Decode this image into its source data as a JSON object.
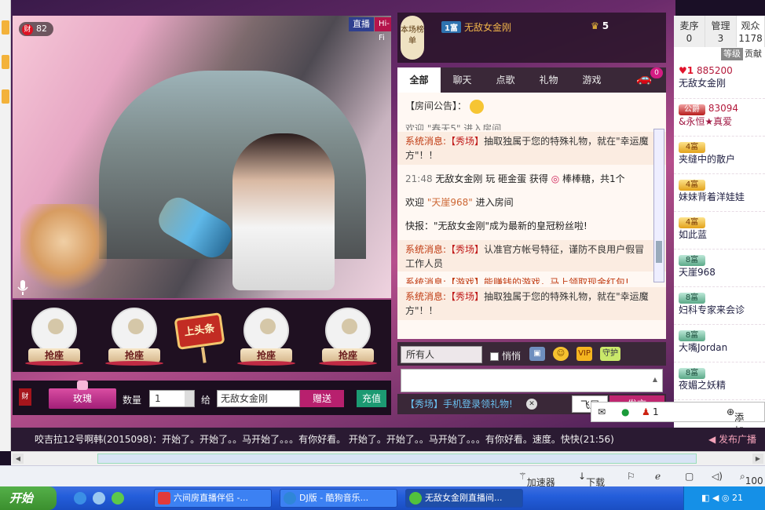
{
  "video": {
    "wealth_count": "82",
    "wealth_icon": "财",
    "live_tag": "直播",
    "hifi_tag": "Hi-Fi"
  },
  "seats": {
    "grab_label": "抢座",
    "headline_label": "上头条"
  },
  "gift_bar": {
    "fortune_icon": "财",
    "gift_name": "玫瑰",
    "qty_label": "数量",
    "qty_value": "1",
    "to_label": "给",
    "recipient": "无敌女金刚",
    "send_label": "赠送",
    "recharge_label": "充值"
  },
  "chat_head": {
    "list_badge": "本场榜单",
    "rank1_tag": "1富",
    "rank1_name": "无敌女金刚",
    "viewer_count": "5"
  },
  "chat_tabs": [
    "全部",
    "聊天",
    "点歌",
    "礼物",
    "游戏"
  ],
  "car_badge": "0",
  "chat": {
    "notice_label": "【房间公告】：",
    "partial_top": "欢迎 \"春天5\" 进入房间",
    "sys1_label": "系统消息:",
    "sys1_tag": "【秀场】",
    "sys1_text": "抽取独属于您的特殊礼物，就在\"幸运魔方\"！！",
    "gift_time": "21:48",
    "gift_user": "无敌女金刚",
    "gift_text": "玩 砸金蛋 获得",
    "gift_prize": "棒棒糖，共1个",
    "welcome_prefix": "欢迎",
    "welcome_name": "\"天崖968\"",
    "welcome_suffix": "进入房间",
    "flash": "快报：\"无敌女金刚\"成为最新的皇冠粉丝啦!",
    "sys2_label": "系统消息:",
    "sys2_tag": "【秀场】",
    "sys2_text": "认准官方帐号特征，谨防不良用户假冒工作人员",
    "partial_mid": "系统消息:【游戏】能赚钱的游戏，马上领取现金红包!",
    "sys3_label": "系统消息:",
    "sys3_tag": "【秀场】",
    "sys3_text": "抽取独属于您的特殊礼物，就在\"幸运魔方\"！！"
  },
  "chat_controls": {
    "target": "所有人",
    "whisper": "悄悄",
    "vip_icon": "VIP",
    "guard_icon": "守护"
  },
  "chat_footer": {
    "promo": "【秀场】手机登录领礼物!",
    "fly_label": "飞屏",
    "send_label": "发言"
  },
  "right_panel": {
    "tabs": [
      {
        "label": "麦序",
        "count": "0"
      },
      {
        "label": "管理",
        "count": "3"
      },
      {
        "label": "观众",
        "count": "1178"
      }
    ],
    "level_label": "等级",
    "contribution_label": "贡献",
    "users": [
      {
        "level": "1",
        "score": "885200",
        "name": "无敌女金刚"
      },
      {
        "level": "公爵",
        "score": "83094",
        "name": "&永恒★真爱"
      },
      {
        "level": "4富",
        "score": "",
        "name": "夹缝中的散户"
      },
      {
        "level": "4富",
        "score": "",
        "name": "妹妹背着洋娃娃"
      },
      {
        "level": "4富",
        "score": "",
        "name": "如此蓝"
      },
      {
        "level": "8富",
        "score": "",
        "name": "天崖968"
      },
      {
        "level": "8富",
        "score": "",
        "name": "妇科专家来会诊"
      },
      {
        "level": "8富",
        "score": "",
        "name": "大嘴Jordan"
      },
      {
        "level": "8富",
        "score": "",
        "name": "夜媚之妖精"
      }
    ]
  },
  "ticker": {
    "text": "咬吉拉12号啊韩(2015098)：开始了。开始了。。马开始了。。。有你好看。 开始了。开始了。。马开始了。。。有你好看。速度。快快(21:56)",
    "broadcast": "发布广播"
  },
  "notify": {
    "user_count": "1",
    "add_label": "添加"
  },
  "statusbar": {
    "accelerator": "加速器",
    "download": "下载",
    "zoom": "100"
  },
  "taskbar": {
    "start": "开始",
    "tasks": [
      "六间房直播伴侣 -...",
      "DJ版 - 酷狗音乐...",
      "无敌女金刚直播间..."
    ],
    "clock": "21"
  }
}
